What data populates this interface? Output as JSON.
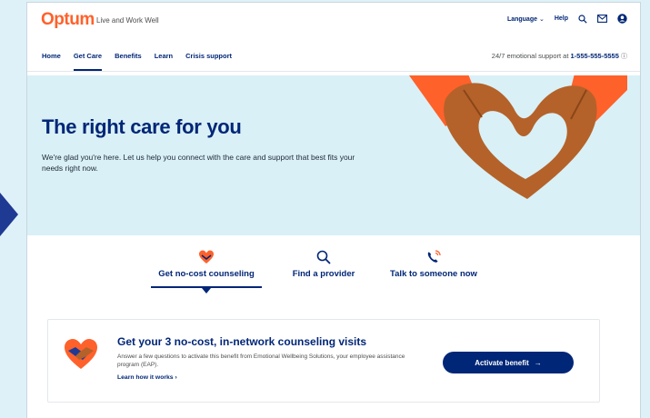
{
  "brand": {
    "logo": "Optum",
    "tagline": "Live and Work Well"
  },
  "header": {
    "language": "Language",
    "help": "Help"
  },
  "nav": {
    "items": [
      {
        "label": "Home"
      },
      {
        "label": "Get Care",
        "active": true
      },
      {
        "label": "Benefits"
      },
      {
        "label": "Learn"
      },
      {
        "label": "Crisis support"
      }
    ],
    "support_prefix": "24/7 emotional support at ",
    "support_phone": "1-555-555-5555"
  },
  "hero": {
    "title": "The right care for you",
    "body": "We're glad you're here. Let us help you connect with the care and support that best fits your needs right now."
  },
  "tabs": [
    {
      "label": "Get no-cost counseling",
      "icon": "heart-hands-icon",
      "active": true
    },
    {
      "label": "Find a provider",
      "icon": "search-icon"
    },
    {
      "label": "Talk to someone now",
      "icon": "phone-icon"
    }
  ],
  "card": {
    "title": "Get your 3 no-cost, in-network counseling visits",
    "description": "Answer a few questions to activate this benefit from Emotional Wellbeing Solutions, your employee assistance program (EAP).",
    "learn_link": "Learn how it works",
    "button": "Activate benefit"
  },
  "colors": {
    "brand_orange": "#ff612b",
    "navy": "#002677",
    "hero_bg": "#d9f0f6",
    "skin": "#b4622a"
  }
}
